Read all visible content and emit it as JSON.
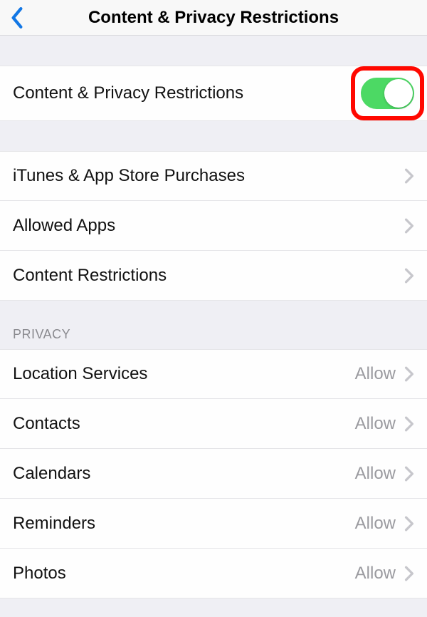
{
  "header": {
    "title": "Content & Privacy Restrictions"
  },
  "toggleRow": {
    "label": "Content & Privacy Restrictions",
    "on": true
  },
  "navRows": [
    {
      "label": "iTunes & App Store Purchases"
    },
    {
      "label": "Allowed Apps"
    },
    {
      "label": "Content Restrictions"
    }
  ],
  "privacy": {
    "header": "PRIVACY",
    "rows": [
      {
        "label": "Location Services",
        "value": "Allow"
      },
      {
        "label": "Contacts",
        "value": "Allow"
      },
      {
        "label": "Calendars",
        "value": "Allow"
      },
      {
        "label": "Reminders",
        "value": "Allow"
      },
      {
        "label": "Photos",
        "value": "Allow"
      }
    ]
  }
}
